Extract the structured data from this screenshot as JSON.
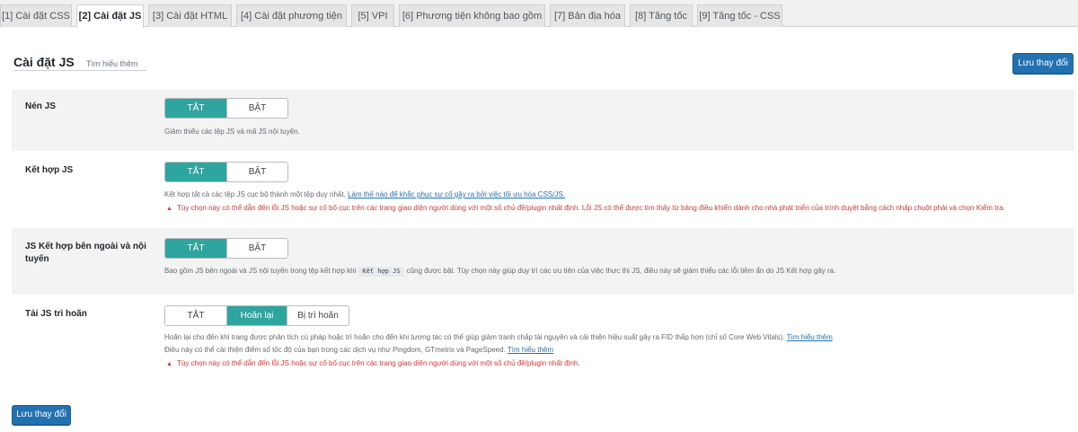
{
  "tabs": [
    {
      "label": "[1] Cài đặt CSS"
    },
    {
      "label": "[2] Cài đặt JS"
    },
    {
      "label": "[3] Cài đặt HTML"
    },
    {
      "label": "[4] Cài đặt phương tiện"
    },
    {
      "label": "[5] VPI"
    },
    {
      "label": "[6] Phương tiện không bao gồm"
    },
    {
      "label": "[7] Bản địa hóa"
    },
    {
      "label": "[8] Tăng tốc"
    },
    {
      "label": "[9] Tăng tốc - CSS"
    }
  ],
  "header": {
    "title": "Cài đặt JS",
    "learn_more": "Tìm hiểu thêm",
    "save_label": "Lưu thay đổi"
  },
  "settings": {
    "minify": {
      "label": "Nén JS",
      "off": "TẮT",
      "on": "BẬT",
      "selected": "TẮT",
      "desc": "Giảm thiểu các tệp JS và mã JS nội tuyến."
    },
    "combine": {
      "label": "Kết hợp JS",
      "off": "TẮT",
      "on": "BẬT",
      "selected": "TẮT",
      "desc": "Kết hợp tất cả các tệp JS cục bộ thành một tệp duy nhất.",
      "desc_link": "Làm thế nào để khắc phục sự cố gây ra bởi việc tối ưu hóa CSS/JS.",
      "warning": "Tùy chọn này có thể dẫn đến lỗi JS hoặc sự cố bố cục trên các trang giao diện người dùng với một số chủ đề/plugin nhất định. Lỗi JS có thể được tìm thấy từ bảng điều khiển dành cho nhà phát triển của trình duyệt bằng cách nhấp chuột phải và chọn Kiểm tra."
    },
    "combine_ext": {
      "label_line1": "JS Kết hợp bên ngoài và nội",
      "label_line2": "tuyến",
      "off": "TẮT",
      "on": "BẬT",
      "selected": "TẮT",
      "desc_before": "Bao gồm JS bên ngoài và JS nội tuyến trong tệp kết hợp khi",
      "desc_code": "Kết hợp JS",
      "desc_after": "cũng được bật. Tùy chọn này giúp duy trì các ưu tiên của việc thực thi JS, điều này sẽ giảm thiểu các lỗi tiềm ẩn do JS Kết hợp gây ra."
    },
    "defer": {
      "label": "Tải JS trì hoãn",
      "opt_off": "TẮT",
      "opt_delay": "Hoãn lại",
      "opt_deferred": "Bị trì hoãn",
      "selected": "Hoãn lại",
      "desc1": "Hoãn lại cho đến khi trang được phân tích cú pháp hoặc trì hoãn cho đến khi tương tác có thể giúp giảm tranh chấp tài nguyên và cải thiện hiệu suất gây ra FID thấp hơn (chỉ số Core Web Vitals).",
      "desc1_link": "Tìm hiểu thêm",
      "desc2": "Điều này có thể cải thiện điểm số tốc độ của bạn trong các dịch vụ như Pingdom, GTmetrix và PageSpeed.",
      "desc2_link": "Tìm hiểu thêm",
      "warning": "Tùy chọn này có thể dẫn đến lỗi JS hoặc sự cố bố cục trên các trang giao diện người dùng với một số chủ đề/plugin nhất định."
    }
  },
  "colors": {
    "accent": "#2ea59f",
    "primary_button": "#2271b1",
    "warning": "#d63638"
  }
}
